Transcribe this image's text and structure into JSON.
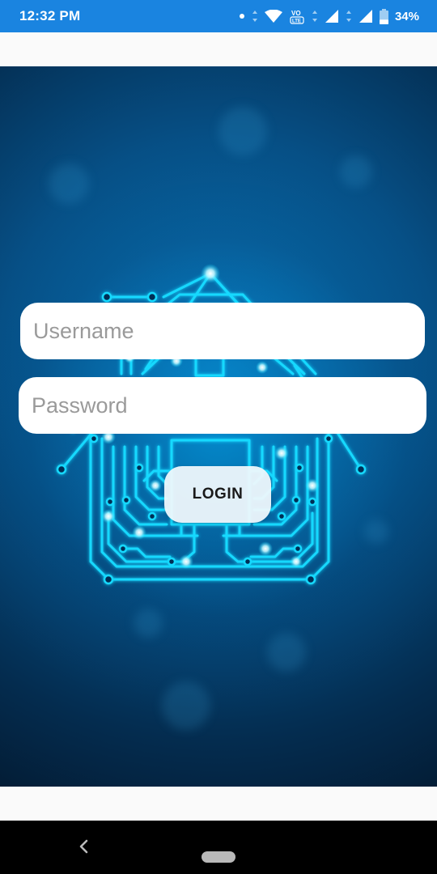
{
  "status_bar": {
    "time": "12:32 PM",
    "battery_percent": "34%",
    "battery_level": 0.34,
    "icons": [
      "notification-dot-icon",
      "data-arrows-icon",
      "wifi-icon",
      "volte-icon",
      "signal-arrows-icon",
      "signal-icon",
      "signal-icon",
      "battery-icon"
    ],
    "background_color": "#1a84e0"
  },
  "login_form": {
    "username": {
      "placeholder": "Username",
      "value": ""
    },
    "password": {
      "placeholder": "Password",
      "value": ""
    },
    "login_label": "LOGIN"
  },
  "background": {
    "artwork": "circuit-house-icon",
    "accent_color": "#00d8ff"
  },
  "nav_bar": {
    "icons": [
      "back-chevron-icon",
      "home-pill-icon"
    ]
  }
}
